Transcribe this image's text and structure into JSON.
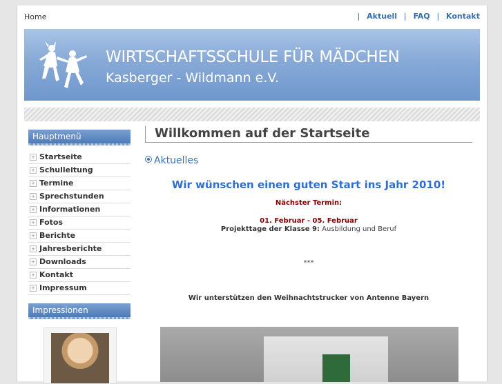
{
  "topbar": {
    "home": "Home",
    "nav": [
      "Aktuell",
      "FAQ",
      "Kontakt"
    ],
    "separator": "|"
  },
  "banner": {
    "title": "WIRTSCHAFTSSCHULE FÜR MÄDCHEN",
    "subtitle": "Kasberger - Wildmann e.V."
  },
  "sidebar": {
    "menu_title": "Hauptmenü",
    "items": [
      "Startseite",
      "Schulleitung",
      "Termine",
      "Sprechstunden",
      "Informationen",
      "Fotos",
      "Berichte",
      "Jahresberichte",
      "Downloads",
      "Kontakt",
      "Impressum"
    ],
    "impressions_title": "Impressionen"
  },
  "main": {
    "page_title": "Willkommen auf der Startseite",
    "section": "Aktuelles",
    "greeting": "Wir wünschen einen guten Start ins Jahr 2010!",
    "next_label": "Nächster Termin:",
    "next_date": "01. Februar - 05. Februar",
    "project_label": "Projekttage der Klasse 9:",
    "project_text": "Ausbildung und Beruf",
    "stars": "***",
    "support": "Wir unterstützen den Weihnachtstrucker von Antenne Bayern"
  },
  "colors": {
    "accent": "#3a6fb0",
    "heading_blue": "#2f6fcf",
    "date_red": "#7a0000",
    "banner": "#87a9d6"
  },
  "icons": {
    "menu_bullet": "plus-box-icon",
    "section_bullet": "radio-circle-icon",
    "logo": "dancing-girls-logo"
  }
}
